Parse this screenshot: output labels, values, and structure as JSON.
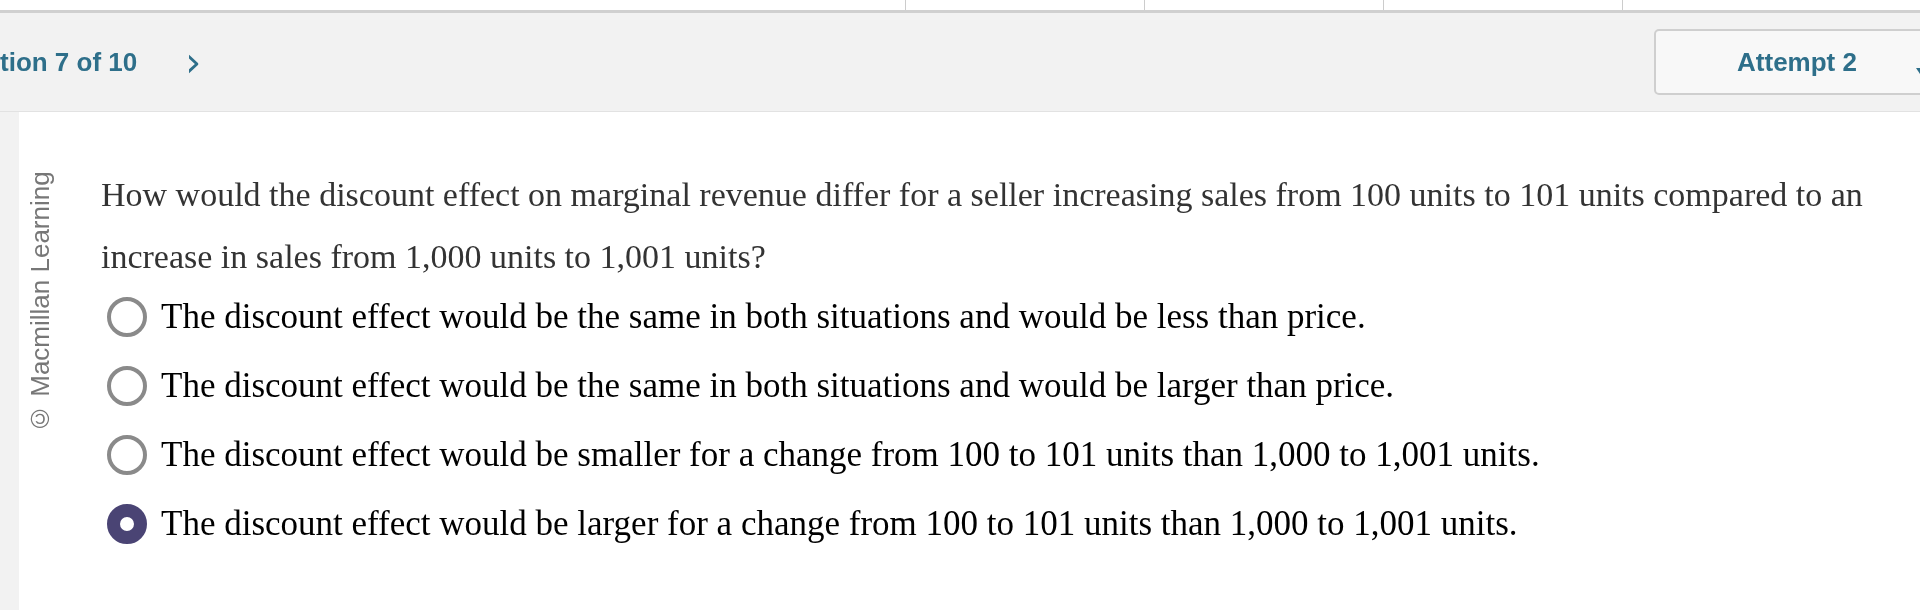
{
  "header": {
    "question_counter": "tion 7 of 10",
    "next_symbol": "›",
    "attempt": "Attempt 2"
  },
  "copyright": "© Macmillan Learning",
  "question": {
    "prompt": "How would the discount effect on marginal revenue differ for a seller increasing sales from 100 units to 101 units compared to an increase in sales from 1,000 units to 1,001 units?",
    "options": [
      {
        "label": "The discount effect would be the same in both situations and would be less than price.",
        "selected": false
      },
      {
        "label": "The discount effect would be the same in both situations and would be larger than price.",
        "selected": false
      },
      {
        "label": "The discount effect would be smaller for a change from 100 to 101 units than 1,000 to 1,001 units.",
        "selected": false
      },
      {
        "label": "The discount effect would be larger for a change from 100 to 101 units than 1,000 to 1,001 units.",
        "selected": true
      }
    ]
  }
}
